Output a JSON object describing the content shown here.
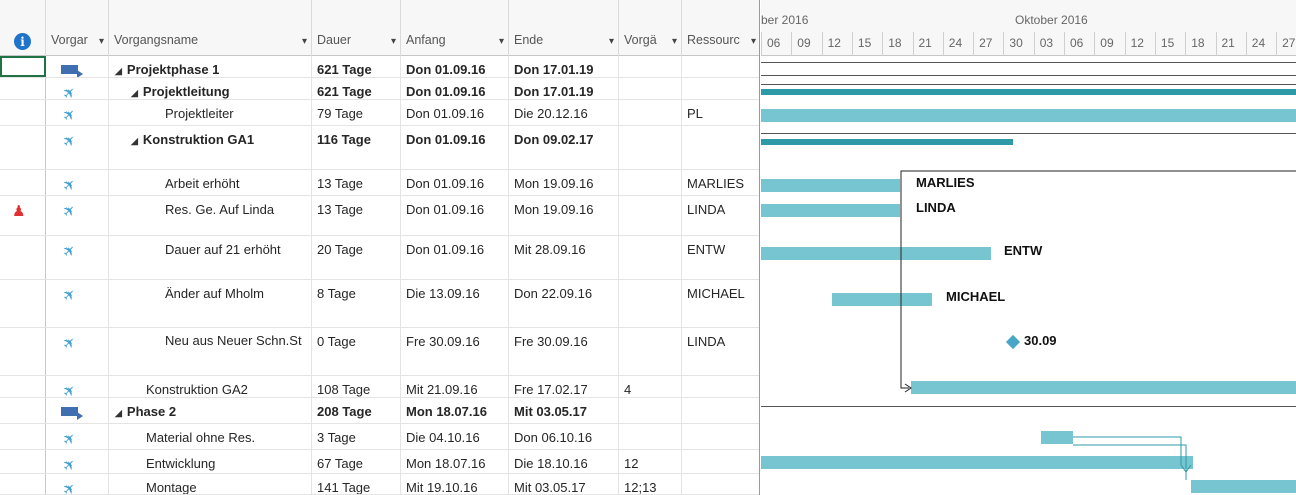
{
  "columns": {
    "info": "i",
    "mode": "Vorgar",
    "name": "Vorgangsname",
    "duration": "Dauer",
    "start": "Anfang",
    "end": "Ende",
    "predecessors": "Vorgä",
    "resources": "Ressourc"
  },
  "rows": [
    {
      "mode": "auto",
      "name": "Projektphase 1",
      "level": 0,
      "summary": true,
      "duration": "621 Tage",
      "start": "Don 01.09.16",
      "end": "Don 17.01.19",
      "pred": "",
      "res": ""
    },
    {
      "mode": "manual",
      "name": "Projektleitung",
      "level": 1,
      "summary": true,
      "duration": "621 Tage",
      "start": "Don 01.09.16",
      "end": "Don 17.01.19",
      "pred": "",
      "res": ""
    },
    {
      "mode": "manual",
      "name": "Projektleiter",
      "level": 2,
      "summary": false,
      "duration": "79 Tage",
      "start": "Don 01.09.16",
      "end": "Die 20.12.16",
      "pred": "",
      "res": "PL"
    },
    {
      "mode": "manual",
      "name": "Konstruktion GA1",
      "level": 1,
      "summary": true,
      "duration": "116 Tage",
      "start": "Don 01.09.16",
      "end": "Don 09.02.17",
      "pred": "",
      "res": ""
    },
    {
      "mode": "manual",
      "name": "Arbeit erhöht",
      "level": 2,
      "summary": false,
      "duration": "13 Tage",
      "start": "Don 01.09.16",
      "end": "Mon 19.09.16",
      "pred": "",
      "res": "MARLIES"
    },
    {
      "mode": "manual",
      "name": "Res. Ge. Auf Linda",
      "level": 2,
      "summary": false,
      "duration": "13 Tage",
      "start": "Don 01.09.16",
      "end": "Mon 19.09.16",
      "pred": "",
      "res": "LINDA",
      "indicator": "person"
    },
    {
      "mode": "manual",
      "name": "Dauer auf 21 erhöht",
      "level": 2,
      "summary": false,
      "duration": "20 Tage",
      "start": "Don 01.09.16",
      "end": "Mit 28.09.16",
      "pred": "",
      "res": "ENTW"
    },
    {
      "mode": "manual",
      "name": "Änder auf Mholm",
      "level": 2,
      "summary": false,
      "duration": "8 Tage",
      "start": "Die 13.09.16",
      "end": "Don 22.09.16",
      "pred": "",
      "res": "MICHAEL"
    },
    {
      "mode": "manual",
      "name": "Neu aus Neuer Schn.St",
      "level": 2,
      "summary": false,
      "duration": "0 Tage",
      "start": "Fre 30.09.16",
      "end": "Fre 30.09.16",
      "pred": "",
      "res": "LINDA"
    },
    {
      "mode": "manual",
      "name": "Konstruktion GA2",
      "level": 1,
      "summary": false,
      "duration": "108 Tage",
      "start": "Mit 21.09.16",
      "end": "Fre 17.02.17",
      "pred": "4",
      "res": ""
    },
    {
      "mode": "auto",
      "name": "Phase 2",
      "level": 0,
      "summary": true,
      "duration": "208 Tage",
      "start": "Mon 18.07.16",
      "end": "Mit 03.05.17",
      "pred": "",
      "res": ""
    },
    {
      "mode": "manual",
      "name": "Material ohne Res.",
      "level": 1,
      "summary": false,
      "duration": "3 Tage",
      "start": "Die 04.10.16",
      "end": "Don 06.10.16",
      "pred": "",
      "res": ""
    },
    {
      "mode": "manual",
      "name": "Entwicklung",
      "level": 1,
      "summary": false,
      "duration": "67 Tage",
      "start": "Mon 18.07.16",
      "end": "Die 18.10.16",
      "pred": "12",
      "res": ""
    },
    {
      "mode": "manual",
      "name": "Montage",
      "level": 1,
      "summary": false,
      "duration": "141 Tage",
      "start": "Mit 19.10.16",
      "end": "Mit 03.05.17",
      "pred": "12;13",
      "res": ""
    }
  ],
  "timescale": {
    "months": [
      "ber 2016",
      "Oktober 2016"
    ],
    "days": [
      "06",
      "09",
      "12",
      "15",
      "18",
      "21",
      "24",
      "27",
      "30",
      "03",
      "06",
      "09",
      "12",
      "15",
      "18",
      "21",
      "24",
      "27"
    ]
  },
  "gantt_labels": {
    "marlies": "MARLIES",
    "linda": "LINDA",
    "entw": "ENTW",
    "michael": "MICHAEL",
    "milestone": "30.09"
  },
  "colors": {
    "task_bar": "#76c5d0",
    "summary_bar": "#2e9aa7",
    "info_icon": "#1f73c8",
    "pin": "#46a0d3",
    "person_indicator": "#e23131"
  }
}
